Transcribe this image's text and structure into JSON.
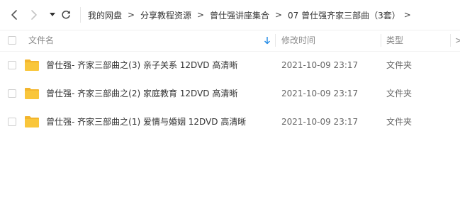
{
  "breadcrumb": {
    "items": [
      "我的网盘",
      "分享教程资源",
      "曾仕强讲座集合",
      "07 曾仕强齐家三部曲（3套）"
    ],
    "separator": ">"
  },
  "columns": {
    "name": "文件名",
    "modified": "修改时间",
    "type": "类型"
  },
  "files": [
    {
      "name": "曾仕强- 齐家三部曲之(3) 亲子关系 12DVD 高清晰",
      "modified": "2021-10-09 23:17",
      "type": "文件夹"
    },
    {
      "name": "曾仕强- 齐家三部曲之(2) 家庭教育 12DVD 高清晰",
      "modified": "2021-10-09 23:17",
      "type": "文件夹"
    },
    {
      "name": "曾仕强- 齐家三部曲之(1) 爱情与婚姻 12DVD 高清晰",
      "modified": "2021-10-09 23:17",
      "type": "文件夹"
    }
  ],
  "colors": {
    "folder": "#f9c63b",
    "folder_tab": "#f3b52d",
    "sort_arrow": "#1e88e5"
  }
}
